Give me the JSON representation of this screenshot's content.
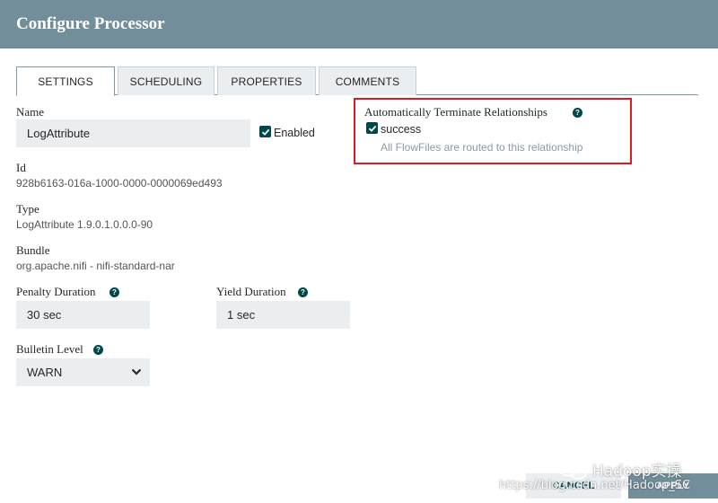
{
  "dialog": {
    "title": "Configure Processor"
  },
  "tabs": [
    {
      "label": "SETTINGS",
      "active": true
    },
    {
      "label": "SCHEDULING",
      "active": false
    },
    {
      "label": "PROPERTIES",
      "active": false
    },
    {
      "label": "COMMENTS",
      "active": false
    }
  ],
  "settings": {
    "name_label": "Name",
    "name_value": "LogAttribute",
    "enabled_label": "Enabled",
    "enabled_checked": true,
    "id_label": "Id",
    "id_value": "928b6163-016a-1000-0000-0000069ed493",
    "type_label": "Type",
    "type_value": "LogAttribute 1.9.0.1.0.0.0-90",
    "bundle_label": "Bundle",
    "bundle_value": "org.apache.nifi - nifi-standard-nar",
    "penalty_label": "Penalty Duration",
    "penalty_value": "30 sec",
    "yield_label": "Yield Duration",
    "yield_value": "1 sec",
    "bulletin_label": "Bulletin Level",
    "bulletin_value": "WARN"
  },
  "relationships": {
    "title": "Automatically Terminate Relationships",
    "items": [
      {
        "name": "success",
        "checked": true,
        "description": "All FlowFiles are routed to this relationship"
      }
    ]
  },
  "buttons": {
    "cancel": "CANCEL",
    "apply": "APPLY"
  },
  "watermark": {
    "brand": "Hadoop实操",
    "url": "https://blog.csdn.net/Hadoop_SC"
  },
  "colors": {
    "header": "#728e9b",
    "accent": "#004849",
    "field_bg": "#eaeef0",
    "highlight_border": "#e0191f"
  },
  "icons": {
    "help": "question-circle-icon",
    "checkbox": "check-icon",
    "select": "chevron-down-icon",
    "wechat": "wechat-icon"
  }
}
